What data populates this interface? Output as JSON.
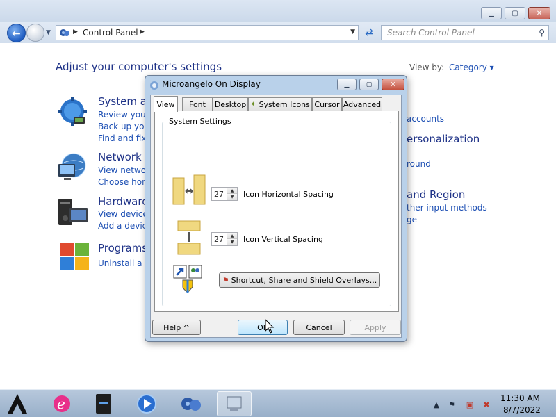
{
  "explorer": {
    "breadcrumb": "Control Panel",
    "search_placeholder": "Search Control Panel"
  },
  "control_panel": {
    "heading": "Adjust your computer's settings",
    "view_by_label": "View by:",
    "view_by_value": "Category ▾",
    "categories": [
      {
        "title": "System ar",
        "links": [
          "Review your",
          "Back up your",
          "Find and fix p"
        ]
      },
      {
        "title": "Network a",
        "links": [
          "View network",
          "Choose hom"
        ]
      },
      {
        "title": "Hardware",
        "links": [
          "View devices",
          "Add a device"
        ]
      },
      {
        "title": "Programs",
        "links": [
          "Uninstall a pr"
        ]
      }
    ],
    "right_fragments": {
      "accounts": "accounts",
      "personalization": "ersonalization",
      "round": "round",
      "region": "and Region",
      "input_methods": "ther input methods",
      "ge": "ge"
    }
  },
  "dialog": {
    "title": "Microangelo On Display",
    "tabs": [
      "View",
      "Font",
      "Desktop",
      "System Icons",
      "Cursor",
      "Advanced"
    ],
    "active_tab": "View",
    "group_label": "System Settings",
    "horizontal_spacing": {
      "value": "27",
      "label": "Icon Horizontal Spacing"
    },
    "vertical_spacing": {
      "value": "27",
      "label": "Icon Vertical Spacing"
    },
    "overlays_button": "Shortcut, Share and Shield Overlays...",
    "buttons": {
      "help": "Help ^",
      "ok": "OK",
      "cancel": "Cancel",
      "apply": "Apply"
    }
  },
  "taskbar": {
    "time": "11:30 AM",
    "date": "8/7/2022"
  },
  "colors": {
    "link": "#1e50b4",
    "heading": "#1e3287",
    "dialog_frame": "#b9d1ea"
  }
}
